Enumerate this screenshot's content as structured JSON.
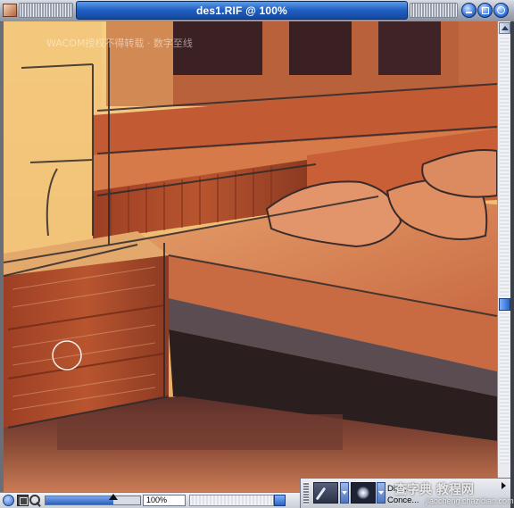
{
  "window": {
    "title": "des1.RIF @ 100%",
    "icon": "painter-document-icon",
    "buttons": [
      "collapse-button",
      "zoom-button",
      "close-button"
    ]
  },
  "canvas": {
    "watermark": "WACOM授权不得转载 · 数字至线",
    "subject": "painted bedroom: wooden bed with pillows, nightstand, window",
    "cursor": "brush-circle-cursor",
    "colors": {
      "wood": "#a8482a",
      "bed": "#d9875a",
      "wall": "#f0c273",
      "floor": "#8a4a36",
      "shadow": "#2b1e1e"
    }
  },
  "statusbar": {
    "zoom_value": "100%",
    "zoom_fraction": 0.72,
    "icons": [
      "tracing-paper-icon",
      "grabber-icon",
      "magnifier-icon"
    ]
  },
  "propbar": {
    "label_1": "Dist...",
    "label_2": "Conce...",
    "watermark_1": "查字典 教程网",
    "watermark_2": "jiaocheng.chazidian.com"
  },
  "accent": "#1e5fc4"
}
